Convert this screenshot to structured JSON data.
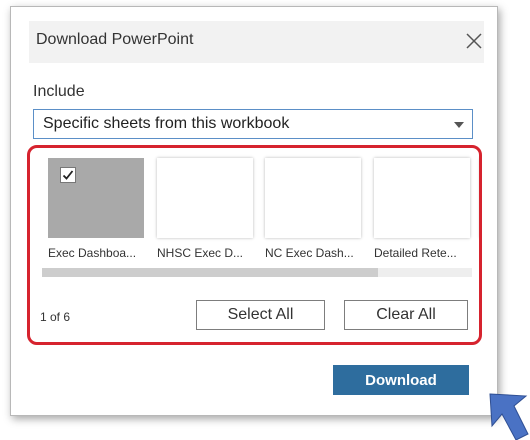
{
  "dialog": {
    "title": "Download PowerPoint",
    "close_icon": "close-icon"
  },
  "include": {
    "label": "Include",
    "selected": "Specific sheets from this workbook",
    "arrow_icon": "caret-down-icon"
  },
  "sheets": [
    {
      "label": "Exec Dashboa...",
      "selected": true
    },
    {
      "label": "NHSC Exec D...",
      "selected": false
    },
    {
      "label": "NC Exec Dash...",
      "selected": false
    },
    {
      "label": "Detailed Rete...",
      "selected": false
    }
  ],
  "page_count": "1 of 6",
  "buttons": {
    "select_all": "Select All",
    "clear_all": "Clear All",
    "download": "Download"
  },
  "colors": {
    "highlight_border": "#d6232e",
    "download_button": "#2e6d9e",
    "select_border": "#5b8fc7",
    "pointer_arrow": "#4a72c4"
  }
}
